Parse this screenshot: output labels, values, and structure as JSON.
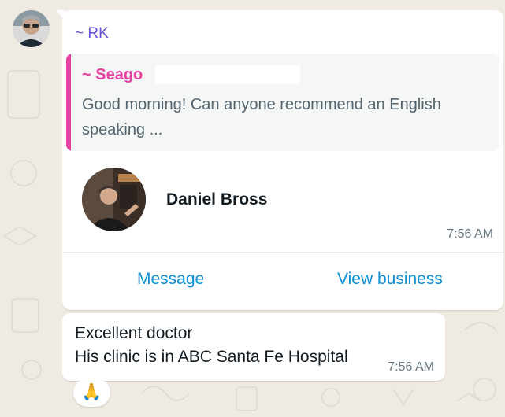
{
  "chat": {
    "background_color": "#efeae2",
    "message_1": {
      "sender": "~ RK",
      "sender_color": "#6a4fd0",
      "quoted": {
        "sender": "~ Seago",
        "sender_color": "#e542a3",
        "text": "Good morning! Can anyone recommend an English speaking ..."
      },
      "contact_card": {
        "name": "Daniel Bross",
        "time": "7:56 AM",
        "actions": {
          "message": "Message",
          "view_business": "View business"
        },
        "action_color": "#0b8fd6"
      }
    },
    "message_2": {
      "line_1": "Excellent doctor",
      "line_2": "His clinic is in ABC Santa Fe Hospital",
      "time": "7:56 AM",
      "reaction": "🙏"
    }
  }
}
